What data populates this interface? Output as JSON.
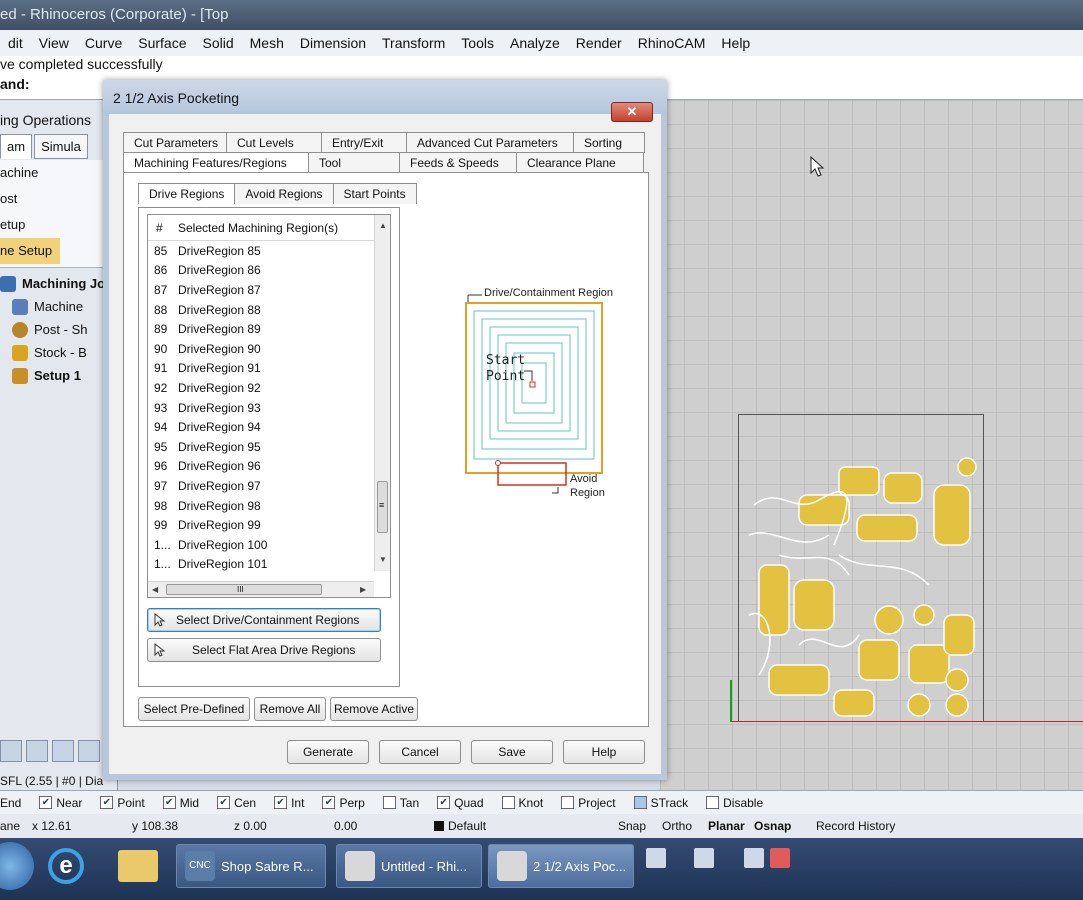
{
  "app": {
    "title": "ed - Rhinoceros (Corporate) - [Top",
    "menu": [
      "dit",
      "View",
      "Curve",
      "Surface",
      "Solid",
      "Mesh",
      "Dimension",
      "Transform",
      "Tools",
      "Analyze",
      "Render",
      "RhinoCAM",
      "Help"
    ],
    "command_history": "ve completed successfully",
    "command_prompt": "and:"
  },
  "left_panel": {
    "title": "ing Operations",
    "tabs": [
      "am",
      "Simula"
    ],
    "ribbon": [
      "achine",
      "ost",
      "etup",
      "ne Setup"
    ],
    "tree": [
      {
        "label": "Machining Jol",
        "icon": "machining-job-icon",
        "color": "#3b6fb0"
      },
      {
        "label": "Machine",
        "icon": "machine-icon",
        "color": "#5a7fb8"
      },
      {
        "label": "Post - Sh",
        "icon": "post-processor-icon",
        "color": "#b8862a"
      },
      {
        "label": "Stock - B",
        "icon": "stock-box-icon",
        "color": "#d9a520"
      },
      {
        "label": "Setup 1",
        "icon": "setup-icon",
        "color": "#c98e2a"
      }
    ]
  },
  "dialog": {
    "title": "2 1/2 Axis Pocketing",
    "close_label": "✕",
    "tabs_back": [
      "Cut Parameters",
      "Cut Levels",
      "Entry/Exit",
      "Advanced Cut Parameters",
      "Sorting"
    ],
    "tabs_front": [
      "Machining Features/Regions",
      "Tool",
      "Feeds & Speeds",
      "Clearance Plane"
    ],
    "subtabs": [
      "Drive Regions",
      "Avoid Regions",
      "Start Points"
    ],
    "list": {
      "col_num": "#",
      "col_name": "Selected Machining Region(s)",
      "rows": [
        {
          "num": "85",
          "name": "DriveRegion 85"
        },
        {
          "num": "86",
          "name": "DriveRegion 86"
        },
        {
          "num": "87",
          "name": "DriveRegion 87"
        },
        {
          "num": "88",
          "name": "DriveRegion 88"
        },
        {
          "num": "89",
          "name": "DriveRegion 89"
        },
        {
          "num": "90",
          "name": "DriveRegion 90"
        },
        {
          "num": "91",
          "name": "DriveRegion 91"
        },
        {
          "num": "92",
          "name": "DriveRegion 92"
        },
        {
          "num": "93",
          "name": "DriveRegion 93"
        },
        {
          "num": "94",
          "name": "DriveRegion 94"
        },
        {
          "num": "95",
          "name": "DriveRegion 95"
        },
        {
          "num": "96",
          "name": "DriveRegion 96"
        },
        {
          "num": "97",
          "name": "DriveRegion 97"
        },
        {
          "num": "98",
          "name": "DriveRegion 98"
        },
        {
          "num": "99",
          "name": "DriveRegion 99"
        },
        {
          "num": "1...",
          "name": "DriveRegion 100"
        },
        {
          "num": "1...",
          "name": "DriveRegion 101"
        }
      ],
      "hscroll_grip": "III",
      "vscroll_grip": "≡"
    },
    "btn_select_drive": "Select Drive/Containment Regions",
    "btn_select_flat": "Select Flat Area Drive Regions",
    "btn_predefined": "Select Pre-Defined",
    "btn_remove_all": "Remove All",
    "btn_remove_active": "Remove Active",
    "diagram": {
      "drive_label": "Drive/Containment Region",
      "start_label_1": "Start",
      "start_label_2": "Point",
      "avoid_label_1": "Avoid",
      "avoid_label_2": "Region",
      "drive_color": "#e0a020",
      "avoid_color": "#d03020",
      "toolpath_color": "#66c2d4"
    },
    "footer": {
      "generate": "Generate",
      "cancel": "Cancel",
      "save": "Save",
      "help": "Help"
    }
  },
  "osnap": {
    "items": [
      {
        "label": "End",
        "checked": false
      },
      {
        "label": "Near",
        "checked": true
      },
      {
        "label": "Point",
        "checked": true
      },
      {
        "label": "Mid",
        "checked": true
      },
      {
        "label": "Cen",
        "checked": true
      },
      {
        "label": "Int",
        "checked": true
      },
      {
        "label": "Perp",
        "checked": true
      },
      {
        "label": "Tan",
        "checked": false
      },
      {
        "label": "Quad",
        "checked": true
      },
      {
        "label": "Knot",
        "checked": false
      },
      {
        "label": "Project",
        "checked": false
      },
      {
        "label": "STrack",
        "checked": false
      },
      {
        "label": "Disable",
        "checked": false
      }
    ],
    "left_fragment": "SFL (2.55 | #0 | Dia"
  },
  "status": {
    "plane": "ane",
    "x": "x 12.61",
    "y": "y 108.38",
    "z": "z 0.00",
    "val": "0.00",
    "layer": "Default",
    "snap": "Snap",
    "ortho": "Ortho",
    "planar": "Planar",
    "osnap": "Osnap",
    "record_history": "Record History"
  },
  "taskbar": {
    "items": [
      "Shop Sabre R...",
      "Untitled - Rhi...",
      "2 1/2 Axis Poc..."
    ],
    "cnc_label": "CNC"
  },
  "colors": {
    "accent": "#3c7fb1",
    "part_fill": "#e6c23a"
  }
}
